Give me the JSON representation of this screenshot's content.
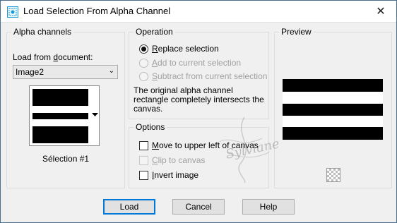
{
  "window": {
    "title": "Load Selection From Alpha Channel",
    "close": "✕"
  },
  "alpha_channels": {
    "title": "Alpha channels",
    "load_from_prefix": "Load from ",
    "load_from_underlined": "d",
    "load_from_suffix": "ocument:",
    "document_value": "Image2",
    "selection_label": "Sélection #1"
  },
  "operation": {
    "title": "Operation",
    "replace": {
      "u": "R",
      "rest": "eplace selection",
      "checked": true,
      "enabled": true
    },
    "add": {
      "u": "A",
      "rest": "dd to current selection",
      "checked": false,
      "enabled": false
    },
    "subtract": {
      "u": "S",
      "rest": "ubtract from current selection",
      "checked": false,
      "enabled": false
    },
    "info": "The original alpha channel rectangle completely intersects the canvas."
  },
  "options": {
    "title": "Options",
    "move": {
      "u": "M",
      "rest": "ove to upper left of canvas",
      "checked": false,
      "enabled": true
    },
    "clip": {
      "u": "C",
      "rest": "lip to canvas",
      "checked": false,
      "enabled": false
    },
    "invert": {
      "u": "I",
      "rest": "nvert image",
      "checked": false,
      "enabled": true
    }
  },
  "preview": {
    "title": "Preview"
  },
  "buttons": {
    "load": "Load",
    "cancel": "Cancel",
    "help": "Help"
  },
  "watermark": {
    "text": "Sylviane"
  },
  "colors": {
    "accent": "#0078d7",
    "border": "#4a6f8e",
    "icon": "#1a9bd7"
  }
}
